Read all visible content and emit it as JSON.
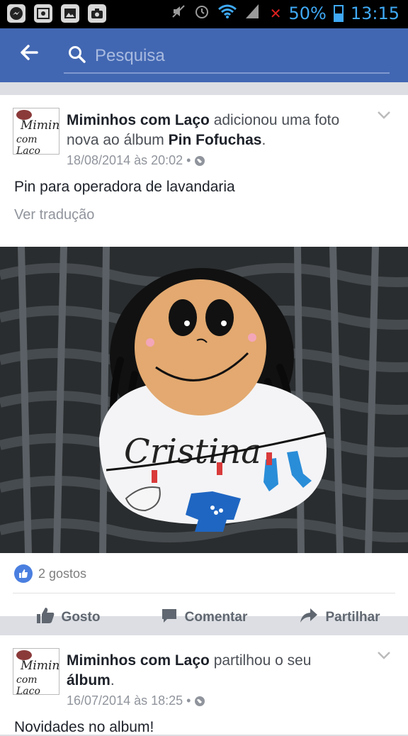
{
  "status_bar": {
    "battery": "50%",
    "time": "13:15",
    "icons": [
      "messenger-icon",
      "gallery-icon",
      "image-icon",
      "camera-icon",
      "mute-icon",
      "alarm-icon",
      "wifi-icon",
      "signal-icon"
    ]
  },
  "app_bar": {
    "search_placeholder": "Pesquisa",
    "accent_color": "#4267b2"
  },
  "posts": [
    {
      "author": "Miminhos com Laço",
      "action_text": " adicionou uma foto nova ao álbum ",
      "album": "Pin Fofuchas",
      "suffix": ".",
      "timestamp": "18/08/2014 às 20:02 •",
      "text": "Pin para operadora de lavandaria",
      "translate": "Ver tradução",
      "photo_label": "Cristina",
      "likes": "2 gostos",
      "actions": {
        "like": "Gosto",
        "comment": "Comentar",
        "share": "Partilhar"
      }
    },
    {
      "author": "Miminhos com Laço",
      "action_text": " partilhou o seu ",
      "album": "álbum",
      "suffix": ".",
      "timestamp": "16/07/2014 às 18:25 •",
      "text": "Novidades no album!"
    }
  ],
  "avatar_text": {
    "line1": "Mimin",
    "line2": "com Laço"
  }
}
